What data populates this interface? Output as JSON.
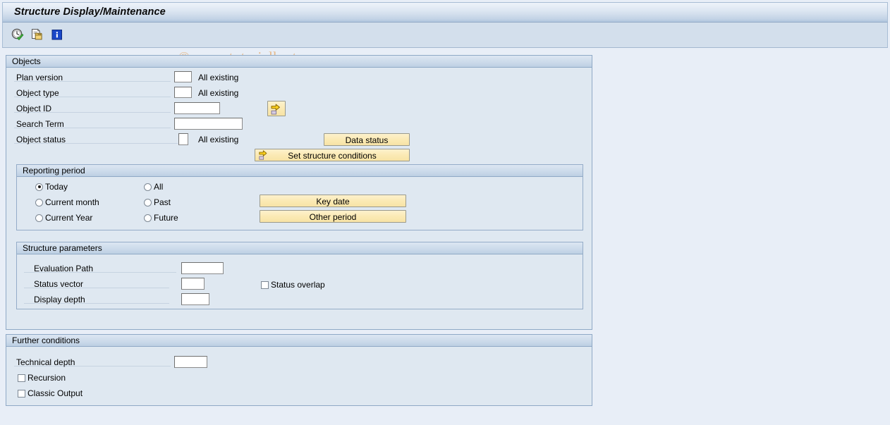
{
  "window": {
    "title": "Structure Display/Maintenance",
    "watermark": "© www.tutorialkart.com"
  },
  "toolbar": {
    "icons": [
      {
        "name": "execute-clock-check-icon",
        "label": "Execute"
      },
      {
        "name": "copy-paste-icon",
        "label": "Get Variant"
      },
      {
        "name": "info-icon",
        "label": "Information"
      }
    ]
  },
  "objects": {
    "title": "Objects",
    "fields": [
      {
        "label": "Plan version",
        "value": "",
        "suffix": "All existing"
      },
      {
        "label": "Object type",
        "value": "",
        "suffix": "All existing"
      },
      {
        "label": "Object ID",
        "value": "",
        "suffix": ""
      },
      {
        "label": "Search Term",
        "value": "",
        "suffix": ""
      },
      {
        "label": "Object status",
        "value": "",
        "suffix": "All existing"
      }
    ],
    "object_id_arrow_button": "⇨",
    "data_status_button": "Data status",
    "set_structure_conditions_button": "Set structure conditions"
  },
  "reporting_period": {
    "title": "Reporting period",
    "options": [
      {
        "label": "Today",
        "selected": true
      },
      {
        "label": "Current month",
        "selected": false
      },
      {
        "label": "Current Year",
        "selected": false
      },
      {
        "label": "All",
        "selected": false
      },
      {
        "label": "Past",
        "selected": false
      },
      {
        "label": "Future",
        "selected": false
      }
    ],
    "key_date_button": "Key date",
    "other_period_button": "Other period"
  },
  "structure_parameters": {
    "title": "Structure parameters",
    "fields": [
      {
        "label": "Evaluation Path",
        "value": ""
      },
      {
        "label": "Status vector",
        "value": ""
      },
      {
        "label": "Display depth",
        "value": ""
      }
    ],
    "status_overlap": {
      "label": "Status overlap",
      "checked": false
    }
  },
  "further_conditions": {
    "title": "Further conditions",
    "technical_depth": {
      "label": "Technical depth",
      "value": ""
    },
    "checkboxes": [
      {
        "label": "Recursion",
        "checked": false
      },
      {
        "label": "Classic Output",
        "checked": false
      }
    ]
  },
  "colors": {
    "panel_bg": "#dfe8f1",
    "page_bg": "#e8eef7",
    "button_yellow": "#fbeab4",
    "watermark": "#e5b98a",
    "border": "#8fa9c6"
  }
}
